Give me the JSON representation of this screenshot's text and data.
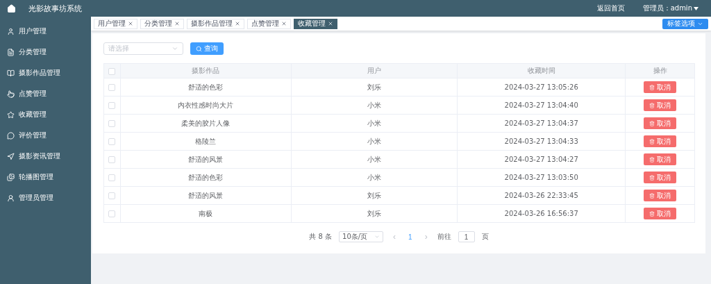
{
  "header": {
    "title": "光影故事坊系统",
    "links": [
      "返回首页"
    ],
    "user": "管理员：admin"
  },
  "sidebar": {
    "items": [
      {
        "label": "用户管理"
      },
      {
        "label": "分类管理"
      },
      {
        "label": "摄影作品管理"
      },
      {
        "label": "点赞管理"
      },
      {
        "label": "收藏管理"
      },
      {
        "label": "评价管理"
      },
      {
        "label": "摄影资讯管理"
      },
      {
        "label": "轮播图管理"
      },
      {
        "label": "管理员管理"
      }
    ]
  },
  "tabs": [
    {
      "label": "用户管理",
      "selected": false
    },
    {
      "label": "分类管理",
      "selected": false
    },
    {
      "label": "摄影作品管理",
      "selected": false
    },
    {
      "label": "点赞管理",
      "selected": false
    },
    {
      "label": "收藏管理",
      "selected": true
    }
  ],
  "tab_options": "标签选项",
  "filter": {
    "placeholder": "请选择",
    "button": "查询"
  },
  "table": {
    "header_checked": false,
    "columns": [
      "摄影作品",
      "用户",
      "收藏时间",
      "操作"
    ],
    "rows": [
      {
        "checked": false,
        "work": "舒适的色彩",
        "user": "刘乐",
        "time": "2024-03-27 13:05:26",
        "action": "取消"
      },
      {
        "checked": false,
        "work": "内衣性感时尚大片",
        "user": "小米",
        "time": "2024-03-27 13:04:40",
        "action": "取消"
      },
      {
        "checked": false,
        "work": "柔美的胶片人像",
        "user": "小米",
        "time": "2024-03-27 13:04:37",
        "action": "取消"
      },
      {
        "checked": false,
        "work": "格陵兰",
        "user": "小米",
        "time": "2024-03-27 13:04:33",
        "action": "取消"
      },
      {
        "checked": false,
        "work": "舒适的风景",
        "user": "小米",
        "time": "2024-03-27 13:04:27",
        "action": "取消"
      },
      {
        "checked": false,
        "work": "舒适的色彩",
        "user": "小米",
        "time": "2024-03-27 13:03:50",
        "action": "取消"
      },
      {
        "checked": false,
        "work": "舒适的风景",
        "user": "刘乐",
        "time": "2024-03-26 22:33:45",
        "action": "取消"
      },
      {
        "checked": false,
        "work": "南极",
        "user": "刘乐",
        "time": "2024-03-26 16:56:37",
        "action": "取消"
      }
    ]
  },
  "pagination": {
    "total": "共 8 条",
    "page_size": "10条/页",
    "prev": "‹",
    "pages": [
      {
        "label": "1",
        "selected": true
      }
    ],
    "next": "›",
    "goto_label": "前往",
    "goto_value": "1",
    "goto_suffix": "页"
  }
}
